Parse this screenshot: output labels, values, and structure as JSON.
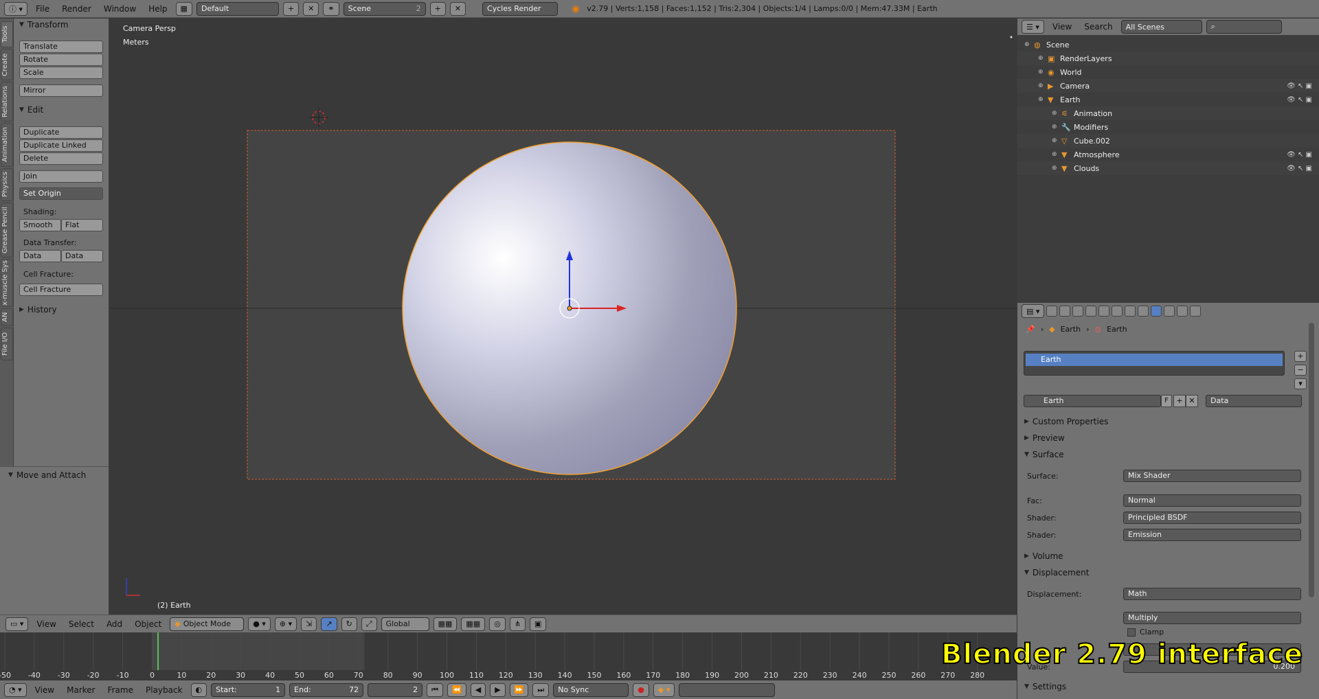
{
  "top_header": {
    "menus": [
      "File",
      "Render",
      "Window",
      "Help"
    ],
    "layout": "Default",
    "scene": "Scene",
    "scene_users": "2",
    "engine": "Cycles Render",
    "stats": "v2.79 | Verts:1,158 | Faces:1,152 | Tris:2,304 | Objects:1/4 | Lamps:0/0 | Mem:47.33M | Earth"
  },
  "tool_tabs": [
    "Tools",
    "Create",
    "Relations",
    "Animation",
    "Physics",
    "Grease Pencil",
    "x-muscle Sys",
    "AN",
    "File I/O"
  ],
  "tool_shelf": {
    "transform_title": "Transform",
    "translate": "Translate",
    "rotate": "Rotate",
    "scale": "Scale",
    "mirror": "Mirror",
    "edit_title": "Edit",
    "duplicate": "Duplicate",
    "duplicate_linked": "Duplicate Linked",
    "delete": "Delete",
    "join": "Join",
    "set_origin": "Set Origin",
    "shading_label": "Shading:",
    "smooth": "Smooth",
    "flat": "Flat",
    "data_transfer_label": "Data Transfer:",
    "data": "Data",
    "data_layout": "Data Layo",
    "cell_fracture_label": "Cell Fracture:",
    "cell_fracture": "Cell Fracture",
    "history_title": "History",
    "move_attach_title": "Move and Attach"
  },
  "viewport": {
    "view_name": "Camera Persp",
    "units": "Meters",
    "object_label": "(2) Earth"
  },
  "viewport_header": {
    "menus": [
      "View",
      "Select",
      "Add",
      "Object"
    ],
    "mode": "Object Mode",
    "orientation": "Global"
  },
  "timeline": {
    "ticks": [
      "-50",
      "-40",
      "-30",
      "-20",
      "-10",
      "0",
      "10",
      "20",
      "30",
      "40",
      "50",
      "60",
      "70",
      "80",
      "90",
      "100",
      "110",
      "120",
      "130",
      "140",
      "150",
      "160",
      "170",
      "180",
      "190",
      "200",
      "210",
      "220",
      "230",
      "240",
      "250",
      "260",
      "270",
      "280"
    ],
    "menus": [
      "View",
      "Marker",
      "Frame",
      "Playback"
    ],
    "start_label": "Start:",
    "start_value": "1",
    "end_label": "End:",
    "end_value": "72",
    "current_frame": "2",
    "sync": "No Sync"
  },
  "outliner": {
    "header_menus": [
      "View",
      "Search"
    ],
    "filter": "All Scenes",
    "rows": [
      {
        "label": "Scene",
        "indent": 0
      },
      {
        "label": "RenderLayers",
        "indent": 1
      },
      {
        "label": "World",
        "indent": 1
      },
      {
        "label": "Camera",
        "indent": 1
      },
      {
        "label": "Earth",
        "indent": 1
      },
      {
        "label": "Animation",
        "indent": 2
      },
      {
        "label": "Modifiers",
        "indent": 2
      },
      {
        "label": "Cube.002",
        "indent": 2
      },
      {
        "label": "Atmosphere",
        "indent": 2
      },
      {
        "label": "Clouds",
        "indent": 2
      }
    ]
  },
  "properties": {
    "breadcrumb": [
      "Earth",
      "Earth"
    ],
    "slot_name": "Earth",
    "material_name": "Earth",
    "fake_user": "F",
    "link_type": "Data",
    "sections": {
      "custom_properties": "Custom Properties",
      "preview": "Preview",
      "surface": "Surface",
      "volume": "Volume",
      "displacement": "Displacement",
      "settings": "Settings"
    },
    "surface_label": "Surface:",
    "surface_value": "Mix Shader",
    "fac_label": "Fac:",
    "fac_value": "Normal",
    "shader1_label": "Shader:",
    "shader1_value": "Principled BSDF",
    "shader2_label": "Shader:",
    "shader2_value": "Emission",
    "displacement_label": "Displacement:",
    "displacement_value": "Math",
    "operation_value": "Multiply",
    "clamp_label": "Clamp",
    "value_label": "Value:",
    "value_value": "0.200"
  },
  "watermark": "Blender 2.79 interface",
  "colors": {
    "selection": "#5680c2",
    "watermark": "#ffff00",
    "object_outline": "#f0a030"
  }
}
